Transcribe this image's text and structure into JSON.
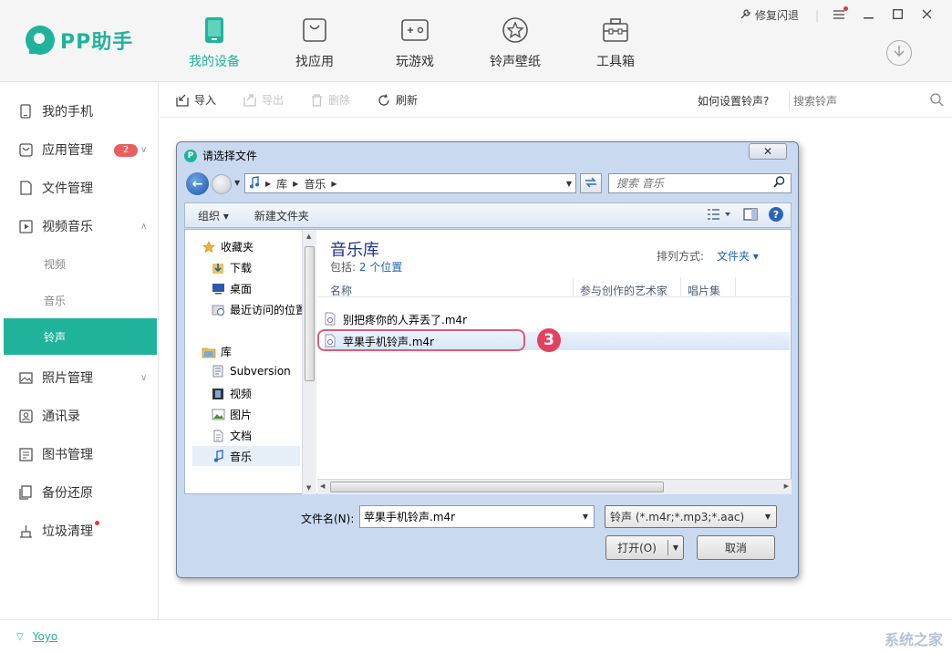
{
  "app": {
    "logo_text": "PP助手",
    "repair_label": "修复闪退",
    "brand_color": "#20b39b"
  },
  "nav": {
    "items": [
      {
        "label": "我的设备",
        "icon": "phone-icon",
        "active": true
      },
      {
        "label": "找应用",
        "icon": "app-bag-icon"
      },
      {
        "label": "玩游戏",
        "icon": "gamepad-icon"
      },
      {
        "label": "铃声壁纸",
        "icon": "star-icon"
      },
      {
        "label": "工具箱",
        "icon": "toolbox-icon"
      }
    ]
  },
  "sidebar": {
    "items": [
      {
        "label": "我的手机"
      },
      {
        "label": "应用管理",
        "badge": "2"
      },
      {
        "label": "文件管理"
      },
      {
        "label": "视频音乐"
      },
      {
        "label": "照片管理"
      },
      {
        "label": "通讯录"
      },
      {
        "label": "图书管理"
      },
      {
        "label": "备份还原"
      },
      {
        "label": "垃圾清理"
      }
    ],
    "subitems": [
      {
        "label": "视频"
      },
      {
        "label": "音乐"
      },
      {
        "label": "铃声",
        "active": true
      }
    ]
  },
  "toolbar": {
    "import_label": "导入",
    "export_label": "导出",
    "delete_label": "删除",
    "refresh_label": "刷新",
    "how_link": "如何设置铃声?",
    "search_placeholder": "搜索铃声"
  },
  "footer": {
    "user": "Yoyo",
    "watermark": "系统之家"
  },
  "dialog": {
    "title": "请选择文件",
    "close": "✕",
    "address": [
      "库",
      "音乐"
    ],
    "search_placeholder": "搜索 音乐",
    "organize_label": "组织 ▾",
    "new_folder_label": "新建文件夹",
    "tree": {
      "favorites": "收藏夹",
      "downloads": "下载",
      "desktop": "桌面",
      "recent": "最近访问的位置",
      "libraries": "库",
      "subversion": "Subversion",
      "videos": "视频",
      "pictures": "图片",
      "documents": "文档",
      "music": "音乐"
    },
    "library_title": "音乐库",
    "library_includes": "包括:",
    "library_locations": "2 个位置",
    "sort_label": "排列方式:",
    "sort_value": "文件夹 ▾",
    "columns": {
      "name": "名称",
      "artist": "参与创作的艺术家",
      "album": "唱片集"
    },
    "files": [
      {
        "name": "别把疼你的人弄丢了.m4r"
      },
      {
        "name": "苹果手机铃声.m4r",
        "selected": true
      }
    ],
    "step_badge": "3",
    "filename_label": "文件名(N):",
    "filename_value": "苹果手机铃声.m4r",
    "filetype_value": "铃声 (*.m4r;*.mp3;*.aac)",
    "open_label": "打开(O)",
    "cancel_label": "取消"
  }
}
